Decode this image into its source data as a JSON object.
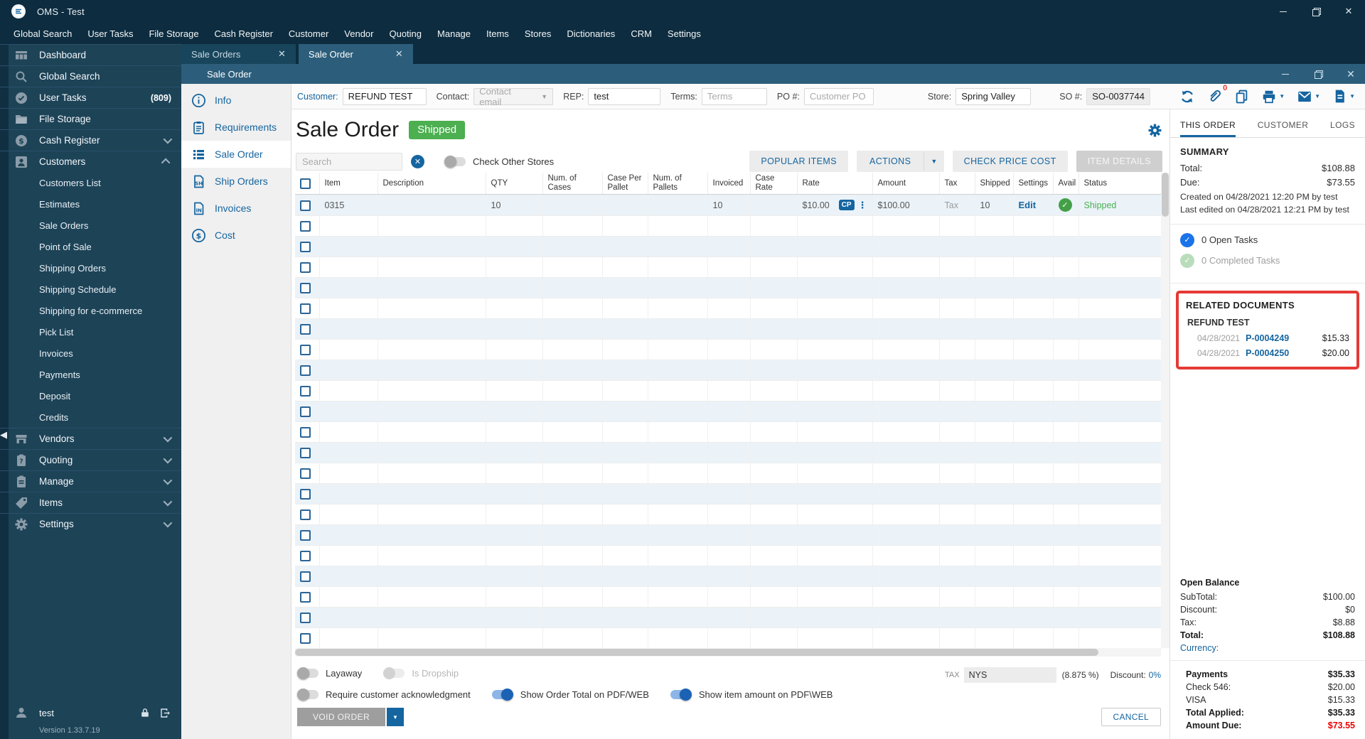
{
  "window": {
    "title": "OMS - Test"
  },
  "menubar": {
    "items": [
      "Global Search",
      "User Tasks",
      "File Storage",
      "Cash Register",
      "Customer",
      "Vendor",
      "Quoting",
      "Manage",
      "Items",
      "Stores",
      "Dictionaries",
      "CRM",
      "Settings"
    ]
  },
  "sidebar": {
    "items": [
      {
        "label": "Dashboard"
      },
      {
        "label": "Global Search"
      },
      {
        "label": "User Tasks",
        "badge": "(809)"
      },
      {
        "label": "File Storage"
      },
      {
        "label": "Cash Register"
      },
      {
        "label": "Customers"
      },
      {
        "label": "Customers List"
      },
      {
        "label": "Estimates"
      },
      {
        "label": "Sale Orders"
      },
      {
        "label": "Point of Sale"
      },
      {
        "label": "Shipping Orders"
      },
      {
        "label": "Shipping Schedule"
      },
      {
        "label": "Shipping for e-commerce"
      },
      {
        "label": "Pick List"
      },
      {
        "label": "Invoices"
      },
      {
        "label": "Payments"
      },
      {
        "label": "Deposit"
      },
      {
        "label": "Credits"
      },
      {
        "label": "Vendors"
      },
      {
        "label": "Quoting"
      },
      {
        "label": "Manage"
      },
      {
        "label": "Items"
      },
      {
        "label": "Settings"
      }
    ],
    "user": {
      "name": "test",
      "version": "Version 1.33.7.19"
    }
  },
  "tabs": [
    {
      "label": "Sale Orders"
    },
    {
      "label": "Sale Order"
    }
  ],
  "inner_window": {
    "title": "Sale Order"
  },
  "fields": {
    "customer": {
      "label": "Customer:",
      "value": "REFUND TEST"
    },
    "contact": {
      "label": "Contact:",
      "placeholder": "Contact email"
    },
    "rep": {
      "label": "REP:",
      "value": "test"
    },
    "terms": {
      "label": "Terms:",
      "placeholder": "Terms"
    },
    "po": {
      "label": "PO #:",
      "placeholder": "Customer PO"
    },
    "store": {
      "label": "Store:",
      "value": "Spring Valley"
    },
    "so": {
      "label": "SO #:",
      "value": "SO-0037744"
    }
  },
  "header_icons": {
    "attachment_count": "0"
  },
  "order": {
    "title": "Sale Order",
    "status": "Shipped"
  },
  "toolbar": {
    "search_placeholder": "Search",
    "check_other_stores": "Check Other Stores",
    "popular": "POPULAR ITEMS",
    "actions": "ACTIONS",
    "check_price": "CHECK PRICE COST",
    "item_details": "ITEM DETAILS"
  },
  "table": {
    "columns": [
      "Item",
      "Description",
      "QTY",
      "Num. of Cases",
      "Case Per Pallet",
      "Num. of Pallets",
      "Invoiced",
      "Case Rate",
      "Rate",
      "Amount",
      "Tax",
      "Shipped",
      "Settings",
      "Avail",
      "Status"
    ],
    "rows": [
      {
        "item": "0315",
        "description": "",
        "qty": "10",
        "num_cases": "",
        "case_per_pallet": "",
        "num_pallets": "",
        "invoiced": "10",
        "case_rate": "",
        "rate": "$10.00",
        "rate_badge": "CP",
        "amount": "$100.00",
        "tax": "Tax",
        "shipped": "10",
        "settings": "Edit",
        "status": "Shipped"
      }
    ],
    "empty_row_count": 21
  },
  "options": {
    "layaway": {
      "label": "Layaway",
      "on": false
    },
    "is_dropship": {
      "label": "Is Dropship",
      "on": false
    },
    "require_ack": {
      "label": "Require customer acknowledgment",
      "on": false
    },
    "show_order_total": {
      "label": "Show Order Total on PDF/WEB",
      "on": true
    },
    "show_item_amount": {
      "label": "Show item amount on PDF\\WEB",
      "on": true
    }
  },
  "tax": {
    "label": "TAX",
    "value": "NYS",
    "rate": "(8.875 %)",
    "discount_label": "Discount:",
    "discount_value": "0%"
  },
  "footer": {
    "void_label": "VOID ORDER",
    "cancel_label": "CANCEL"
  },
  "panel": {
    "tabs": [
      "THIS ORDER",
      "CUSTOMER",
      "LOGS"
    ],
    "summary": {
      "heading": "SUMMARY",
      "rows": [
        {
          "label": "Total:",
          "value": "$108.88"
        },
        {
          "label": "Due:",
          "value": "$73.55"
        }
      ],
      "created": "Created on 04/28/2021 12:20 PM by test",
      "edited": "Last edited on 04/28/2021 12:21 PM by test"
    },
    "tasks": [
      {
        "label": "0 Open Tasks"
      },
      {
        "label": "0 Completed Tasks"
      }
    ],
    "related": {
      "heading": "RELATED DOCUMENTS",
      "customer": "REFUND TEST",
      "docs": [
        {
          "date": "04/28/2021",
          "number": "P-0004249",
          "amount": "$15.33"
        },
        {
          "date": "04/28/2021",
          "number": "P-0004250",
          "amount": "$20.00"
        }
      ]
    },
    "balance": {
      "heading": "Open Balance",
      "rows": [
        {
          "label": "SubTotal:",
          "value": "$100.00"
        },
        {
          "label": "Discount:",
          "value": "$0"
        },
        {
          "label": "Tax:",
          "value": "$8.88"
        },
        {
          "label": "Total:",
          "value": "$108.88"
        }
      ],
      "currency_label": "Currency:"
    },
    "payments": {
      "heading": "Payments",
      "total": "$35.33",
      "rows": [
        {
          "label": "Check 546:",
          "value": "$20.00"
        },
        {
          "label": "VISA",
          "value": "$15.33"
        }
      ],
      "total_applied_label": "Total Applied:",
      "total_applied": "$35.33",
      "amount_due_label": "Amount Due:",
      "amount_due": "$73.55"
    }
  },
  "colors": {
    "accent": "#1565a0",
    "titlebar": "#0d2c3f",
    "inner_titlebar": "#2c5e7b",
    "success": "#4caf50",
    "highlight_border": "#e53935",
    "amount_due_red": "#ee0000"
  }
}
